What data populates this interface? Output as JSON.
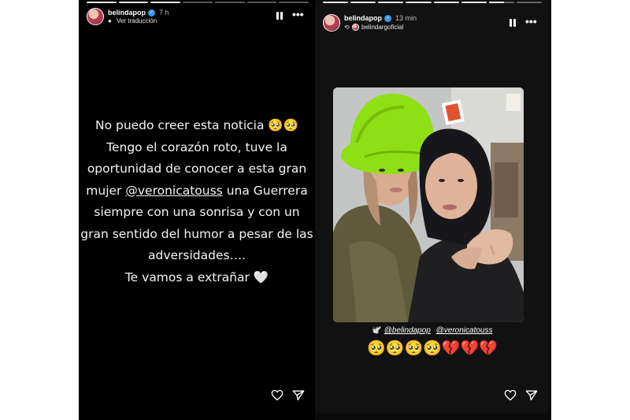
{
  "left_story": {
    "username": "belindapop",
    "time": "7 h",
    "translate_label": "Ver traducción",
    "progress": [
      1,
      1,
      1,
      0,
      0,
      0,
      0
    ],
    "icons": {
      "pause": "pause-icon",
      "more": "more-icon",
      "like": "heart-icon",
      "share": "send-icon"
    },
    "text_lines": [
      "No puedo creer esta noticia 🥺🥺",
      "Tengo el corazón roto, tuve la",
      "oportunidad de conocer a esta gran",
      "una Guerrera",
      "siempre con una sonrisa y con un",
      "gran sentido del humor a pesar de las",
      "adversidades….",
      "Te vamos a extrañar 🤍"
    ],
    "line4_prefix": "mujer",
    "line4_mention": "@veronicatouss"
  },
  "right_story": {
    "username": "belindapop",
    "time": "13 min",
    "reshared_from": "belindargoficial",
    "progress": [
      1,
      1,
      1,
      1,
      1,
      1,
      0.6,
      0
    ],
    "icons": {
      "pause": "pause-icon",
      "more": "more-icon",
      "repost": "repost-icon",
      "dove": "dove-emoji",
      "like": "heart-icon",
      "share": "send-icon"
    },
    "tag_prefix": "🕊️",
    "tags": [
      "@belindapop",
      "@veronicatouss"
    ],
    "emojis": "🥺🥺🥺🥺💔💔💔",
    "colors": {
      "hat": "#8ee014",
      "jacket": "#5f5a3c"
    }
  }
}
